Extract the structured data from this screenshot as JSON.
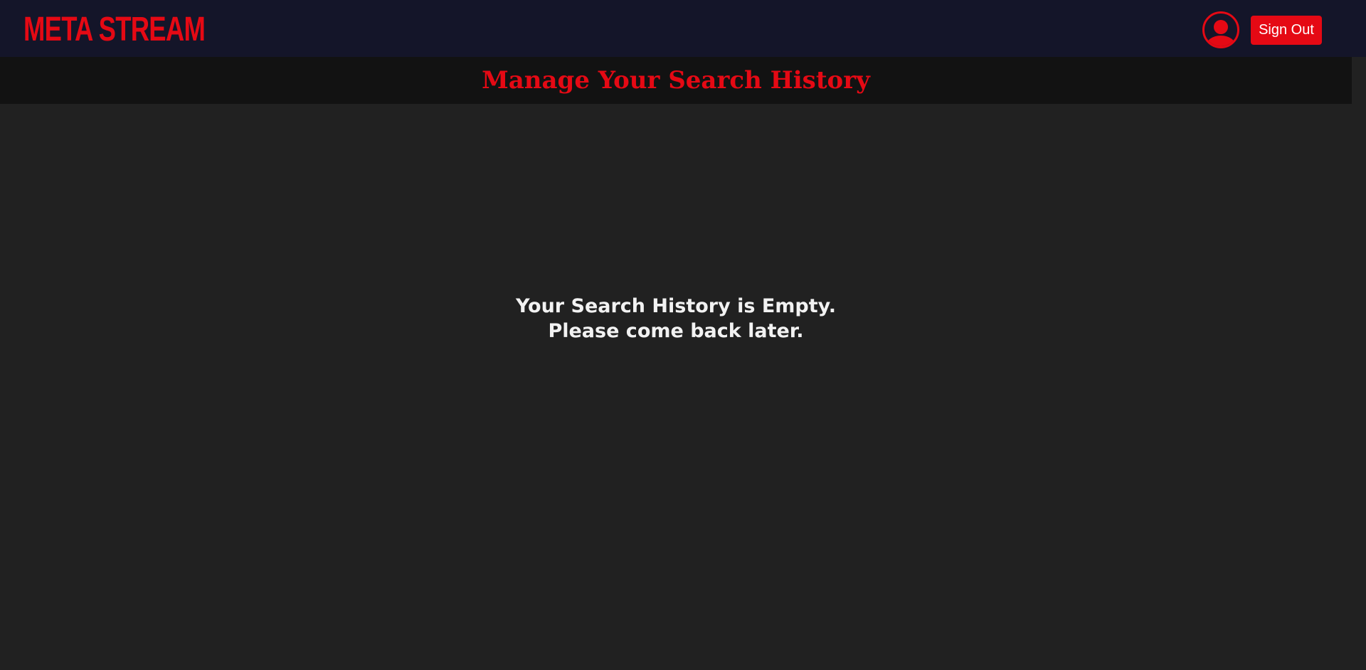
{
  "header": {
    "logo_text": "META STREAM",
    "avatar_icon": "user-avatar-icon",
    "sign_out_label": "Sign Out"
  },
  "main": {
    "title": "Manage Your Search History",
    "empty_line1": "Your Search History is Empty.",
    "empty_line2": "Please come back later."
  },
  "colors": {
    "brand_red": "#e50914",
    "header_bg": "#141529",
    "title_band_bg": "#121212",
    "page_bg": "#212121",
    "text": "#f2f2f2"
  }
}
